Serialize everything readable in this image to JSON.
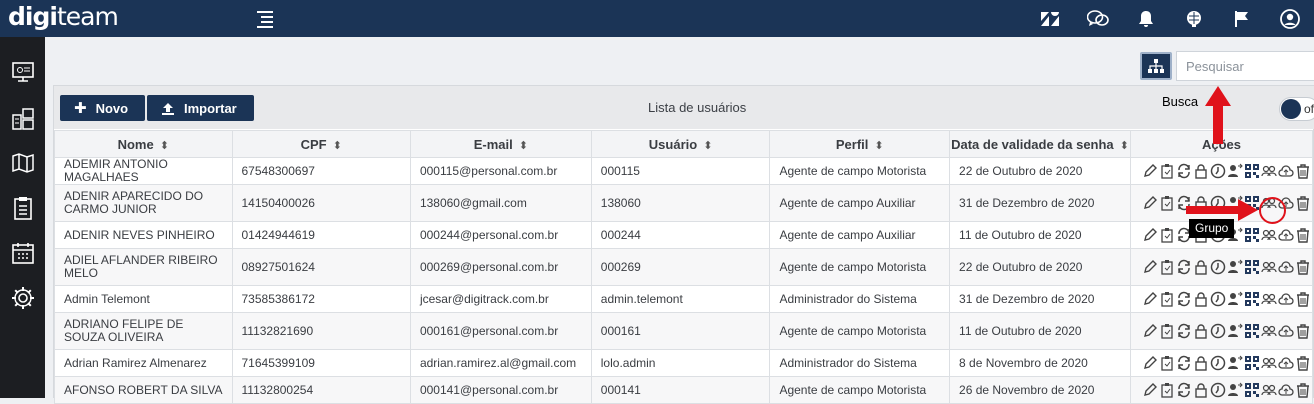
{
  "app": {
    "logo_bold": "digi",
    "logo_light": "team"
  },
  "topbar": {
    "icons": [
      "zendesk-icon",
      "chat-icon",
      "bell-icon",
      "brain-icon",
      "flag-icon",
      "user-icon"
    ]
  },
  "sidebar": {
    "items": [
      "dashboard-icon",
      "hierarchy-icon",
      "map-icon",
      "clipboard-icon",
      "calendar-icon",
      "settings-icon"
    ]
  },
  "search": {
    "placeholder": "Pesquisar",
    "value": ""
  },
  "toolbar": {
    "novo_label": "Novo",
    "importar_label": "Importar",
    "list_title": "Lista de usuários",
    "toggle_label": "off"
  },
  "table": {
    "columns": [
      "Nome",
      "CPF",
      "E-mail",
      "Usuário",
      "Perfil",
      "Data de validade da senha",
      "Ações"
    ],
    "rows": [
      [
        "ADEMIR ANTONIO MAGALHAES",
        "67548300697",
        "000115@personal.com.br",
        "000115",
        "Agente de campo Motorista",
        "22 de Outubro de 2020"
      ],
      [
        "ADENIR APARECIDO DO CARMO JUNIOR",
        "14150400026",
        "138060@gmail.com",
        "138060",
        "Agente de campo Auxiliar",
        "31 de Dezembro de 2020"
      ],
      [
        "ADENIR NEVES PINHEIRO",
        "01424944619",
        "000244@personal.com.br",
        "000244",
        "Agente de campo Auxiliar",
        "11 de Outubro de 2020"
      ],
      [
        "ADIEL AFLANDER RIBEIRO MELO",
        "08927501624",
        "000269@personal.com.br",
        "000269",
        "Agente de campo Motorista",
        "22 de Outubro de 2020"
      ],
      [
        "Admin Telemont",
        "73585386172",
        "jcesar@digitrack.com.br",
        "admin.telemont",
        "Administrador do Sistema",
        "31 de Dezembro de 2020"
      ],
      [
        "ADRIANO FELIPE DE SOUZA OLIVEIRA",
        "11132821690",
        "000161@personal.com.br",
        "000161",
        "Agente de campo Motorista",
        "11 de Outubro de 2020"
      ],
      [
        "Adrian Ramirez Almenarez",
        "71645399109",
        "adrian.ramirez.al@gmail.com",
        "lolo.admin",
        "Administrador do Sistema",
        "8 de Novembro de 2020"
      ],
      [
        "AFONSO ROBERT DA SILVA",
        "11132800254",
        "000141@personal.com.br",
        "000141",
        "Agente de campo Motorista",
        "26 de Novembro de 2020"
      ]
    ],
    "row_actions": [
      "edit-icon",
      "clipboard-icon",
      "refresh-icon",
      "lock-icon",
      "clock-icon",
      "users-swap-icon",
      "qrcode-icon",
      "group-icon",
      "cloud-upload-icon",
      "trash-icon"
    ]
  },
  "annotations": {
    "busca_label": "Busca",
    "tooltip_label": "Grupo"
  },
  "colors": {
    "navy": "#1b3456",
    "sidebar": "#1c1e22",
    "annotation_red": "#e0121b"
  }
}
